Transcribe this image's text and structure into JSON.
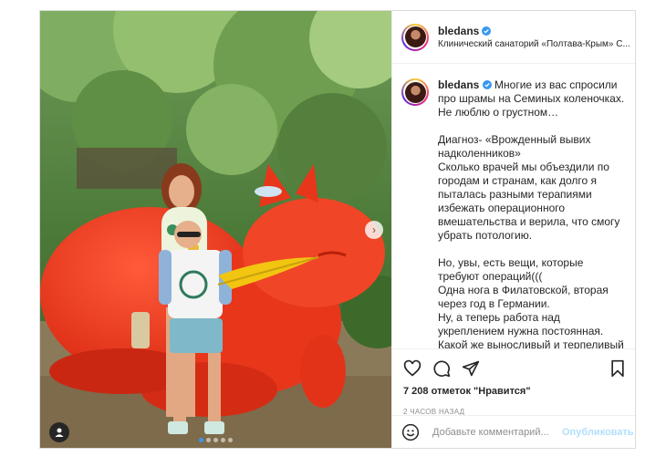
{
  "post": {
    "username": "bledans",
    "location": "Клинический санаторий «Полтава-Крым» С...",
    "caption": [
      "Многие из вас спросили про шрамы на Семиных коленочках.",
      "Не люблю о грустном…",
      "",
      "Диагноз- «Врожденный вывих надколенников»",
      "Сколько врачей мы объездили по городам и странам, как долго я пыталась разными терапиями избежать операционного вмешательства и верила, что смогу убрать потологию.",
      "",
      "Но, увы, есть вещи, которые требуют операций(((",
      "Одна нога в Филатовской, вторая через год в Германии.",
      "Ну, а теперь работа над укреплением нужна постоянная.",
      "Какой же выносливый и терпеливый"
    ],
    "likes": "7 208 отметок \"Нравится\"",
    "time_ago": "2 ЧАСОВ НАЗАД",
    "comment_placeholder": "Добавьте комментарий...",
    "publish_label": "Опубликовать",
    "slides": {
      "current": 1,
      "total": 5
    }
  },
  "colors": {
    "accent": "#3897f0",
    "publish_disabled": "#b2dffc",
    "secondary_text": "#8e8e8e",
    "statue_red": "#ef3a1f"
  },
  "icons": [
    "heart-icon",
    "comment-icon",
    "share-icon",
    "save-icon",
    "emoji-icon",
    "verified-icon",
    "user-tag-icon",
    "chevron-right-icon"
  ]
}
